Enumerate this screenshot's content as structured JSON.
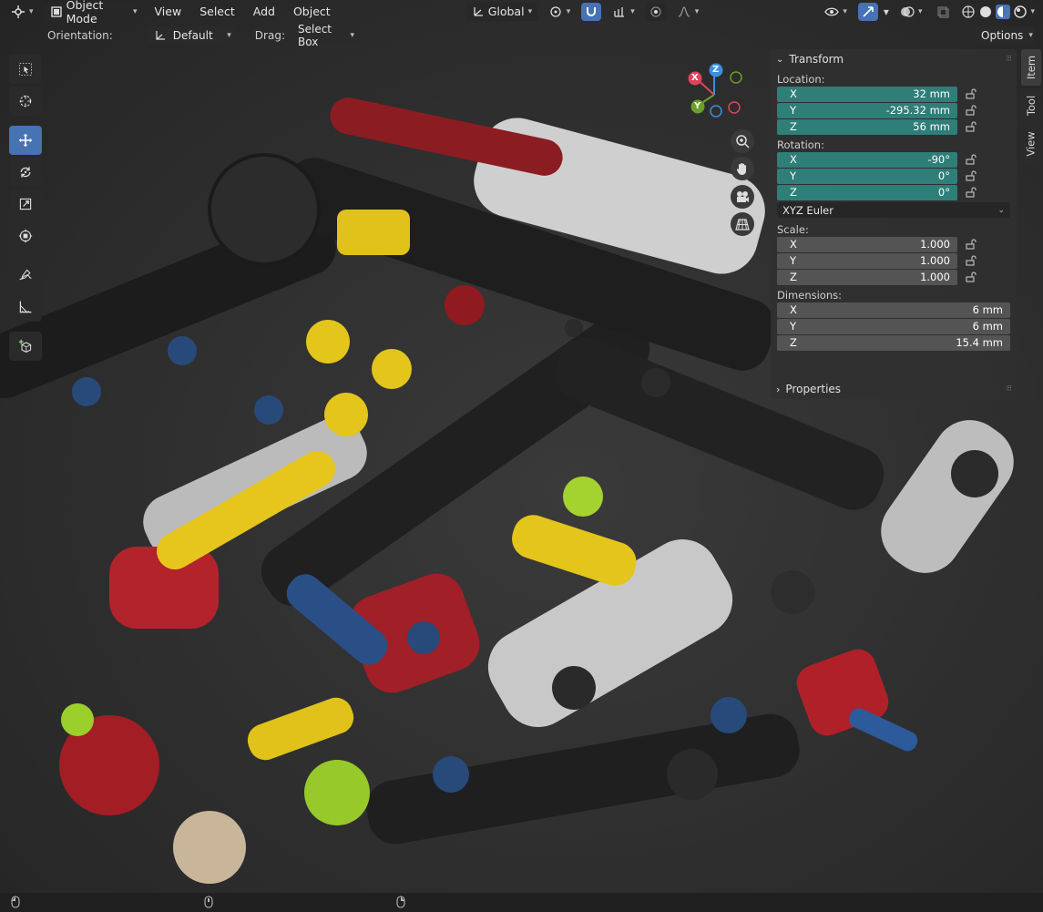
{
  "header": {
    "mode": "Object Mode",
    "menus": [
      "View",
      "Select",
      "Add",
      "Object"
    ],
    "transform_orientation": "Global"
  },
  "tool_settings": {
    "orientation_label": "Orientation:",
    "orientation_value": "Default",
    "drag_label": "Drag:",
    "drag_value": "Select Box",
    "options_label": "Options"
  },
  "tools": [
    "select-box",
    "cursor",
    "move",
    "rotate",
    "scale",
    "transform",
    "annotate",
    "measure",
    "add-cube"
  ],
  "gizmo": {
    "x": "X",
    "y": "Y",
    "z": "Z"
  },
  "npanel": {
    "transform_title": "Transform",
    "location_label": "Location:",
    "location": [
      {
        "axis": "X",
        "value": "32 mm"
      },
      {
        "axis": "Y",
        "value": "-295.32 mm"
      },
      {
        "axis": "Z",
        "value": "56 mm"
      }
    ],
    "rotation_label": "Rotation:",
    "rotation": [
      {
        "axis": "X",
        "value": "-90°"
      },
      {
        "axis": "Y",
        "value": "0°"
      },
      {
        "axis": "Z",
        "value": "0°"
      }
    ],
    "rotation_mode": "XYZ Euler",
    "scale_label": "Scale:",
    "scale": [
      {
        "axis": "X",
        "value": "1.000"
      },
      {
        "axis": "Y",
        "value": "1.000"
      },
      {
        "axis": "Z",
        "value": "1.000"
      }
    ],
    "dimensions_label": "Dimensions:",
    "dimensions": [
      {
        "axis": "X",
        "value": "6 mm"
      },
      {
        "axis": "Y",
        "value": "6 mm"
      },
      {
        "axis": "Z",
        "value": "15.4 mm"
      }
    ],
    "properties_title": "Properties"
  },
  "side_tabs": [
    "Item",
    "Tool",
    "View"
  ],
  "colors": {
    "accent": "#4772b3",
    "field_teal": "#2f7e78",
    "axis_x": "#e0445a",
    "axis_y": "#6aa02a",
    "axis_z": "#3b8fe0"
  }
}
